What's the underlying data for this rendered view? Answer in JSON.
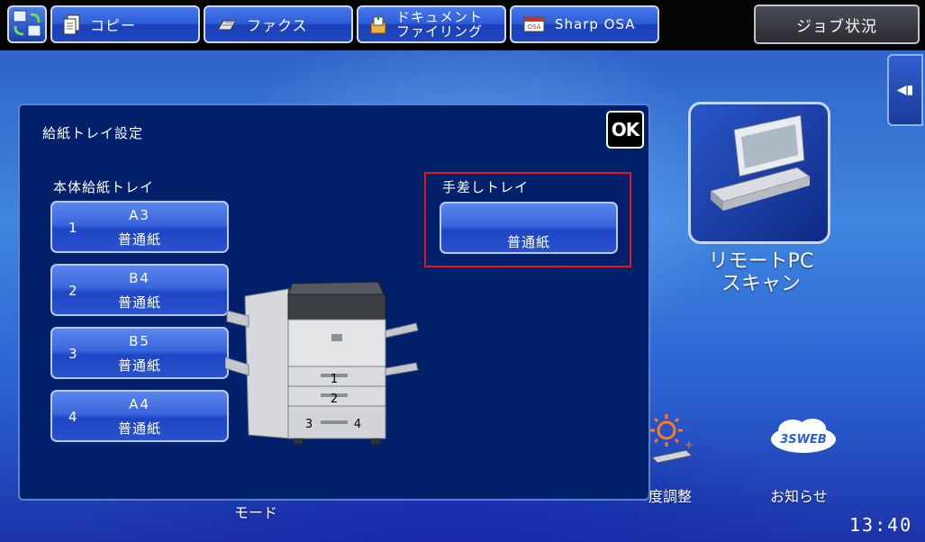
{
  "topbar": {
    "tabs": [
      {
        "label": "コピー",
        "icon": "copy-icon"
      },
      {
        "label": "ファクス",
        "icon": "fax-icon"
      },
      {
        "label_line1": "ドキュメント",
        "label_line2": "ファイリング",
        "icon": "document-filing-icon"
      },
      {
        "label": "Sharp OSA",
        "icon": "osa-icon"
      }
    ],
    "job_status": "ジョブ状況"
  },
  "desktop": {
    "remote_pc_scan_line1": "リモートPC",
    "remote_pc_scan_line2": "スキャン",
    "mode_label": "モード",
    "brightness_label": "度調整",
    "notice_label": "お知らせ",
    "web_logo": "3SWEB",
    "clock": "13:40"
  },
  "dialog": {
    "title": "給紙トレイ設定",
    "ok_label": "OK",
    "main_tray_label": "本体給紙トレイ",
    "trays": [
      {
        "number": "1",
        "size": "A3",
        "type": "普通紙"
      },
      {
        "number": "2",
        "size": "B4",
        "type": "普通紙"
      },
      {
        "number": "3",
        "size": "B5",
        "type": "普通紙"
      },
      {
        "number": "4",
        "size": "A4",
        "type": "普通紙"
      }
    ],
    "bypass_label": "手差しトレイ",
    "bypass": {
      "size": "",
      "type": "普通紙"
    },
    "copier_tray_numbers": [
      "1",
      "2",
      "3",
      "4"
    ]
  },
  "colors": {
    "dialog_bg": "#03206a",
    "button_blue": "#2c5cd9",
    "highlight_red": "#e8141e"
  }
}
